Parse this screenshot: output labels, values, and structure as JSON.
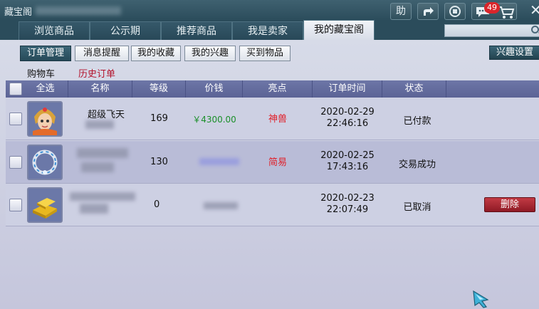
{
  "window": {
    "title": "藏宝阁",
    "help_label": "助",
    "cart_badge": "49"
  },
  "main_tabs": [
    {
      "label": "浏览商品"
    },
    {
      "label": "公示期"
    },
    {
      "label": "推荐商品"
    },
    {
      "label": "我是卖家"
    },
    {
      "label": "我的藏宝阁",
      "active": true
    }
  ],
  "sub_tabs": [
    {
      "label": "订单管理",
      "active": true
    },
    {
      "label": "消息提醒"
    },
    {
      "label": "我的收藏"
    },
    {
      "label": "我的兴趣"
    },
    {
      "label": "买到物品"
    }
  ],
  "interest_settings_label": "兴趣设置",
  "links": {
    "cart": "购物车",
    "history": "历史订单"
  },
  "table": {
    "headers": [
      "全选",
      "名称",
      "等级",
      "价钱",
      "亮点",
      "订单时间",
      "状态"
    ],
    "rows": [
      {
        "name": "超级飞天",
        "level": "169",
        "price": "￥4300.00",
        "highlight": "神兽",
        "date": "2020-02-29",
        "time": "22:46:16",
        "status": "已付款",
        "icon": "character-portrait-icon"
      },
      {
        "name": "",
        "level": "130",
        "price": "",
        "highlight": "简易",
        "date": "2020-02-25",
        "time": "17:43:16",
        "status": "交易成功",
        "icon": "jeweled-ring-icon"
      },
      {
        "name": "",
        "level": "0",
        "price": "",
        "highlight": "",
        "date": "2020-02-23",
        "time": "22:07:49",
        "status": "已取消",
        "icon": "gold-bars-icon",
        "action": "删除"
      }
    ]
  },
  "colors": {
    "accent_dark": "#264a59",
    "header_purple": "#6d76a7",
    "price_green": "#1a8f29",
    "highlight_red": "#e0202a",
    "delete_red": "#a8262f"
  }
}
